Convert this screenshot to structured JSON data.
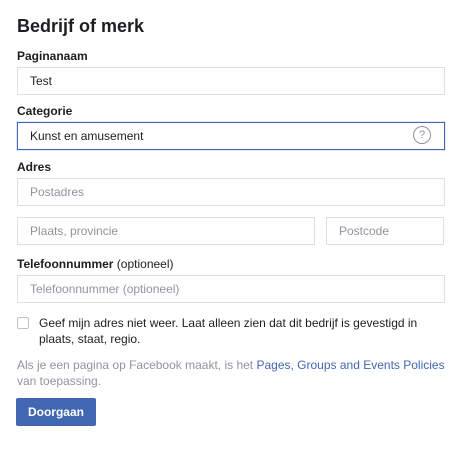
{
  "form": {
    "title": "Bedrijf of merk",
    "page_name": {
      "label": "Paginanaam",
      "value": "Test"
    },
    "category": {
      "label": "Categorie",
      "value": "Kunst en amusement",
      "help_icon_text": "?"
    },
    "address": {
      "label": "Adres",
      "street_placeholder": "Postadres",
      "city_placeholder": "Plaats, provincie",
      "postal_placeholder": "Postcode"
    },
    "phone": {
      "label": "Telefoonnummer",
      "label_optional": "(optioneel)",
      "placeholder": "Telefoonnummer (optioneel)"
    },
    "hide_address": {
      "label": "Geef mijn adres niet weer. Laat alleen zien dat dit bedrijf is gevestigd in plaats, staat, regio.",
      "checked": false
    },
    "policy": {
      "prefix": "Als je een pagina op Facebook maakt, is het ",
      "link": "Pages, Groups and Events Policies",
      "suffix": " van toepassing."
    },
    "submit_label": "Doorgaan"
  },
  "colors": {
    "accent": "#4267b2",
    "border": "#dddfe2",
    "muted_text": "#90949c",
    "text": "#1c1e21"
  },
  "icons": {
    "help": "help-icon"
  }
}
